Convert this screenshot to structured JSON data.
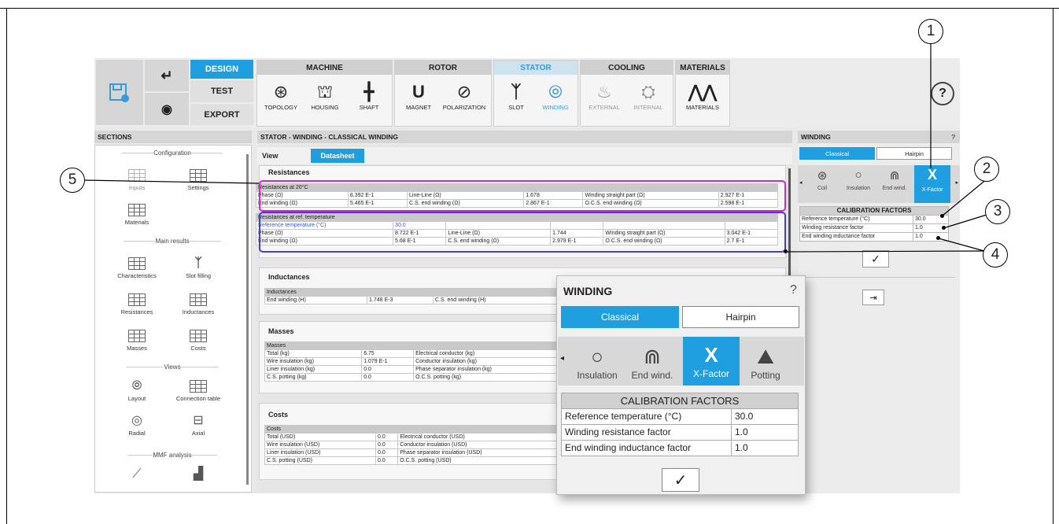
{
  "callouts": [
    "1",
    "2",
    "3",
    "4",
    "5"
  ],
  "toolbar": {
    "modes": {
      "design": "DESIGN",
      "test": "TEST",
      "export": "EXPORT"
    },
    "groups": {
      "machine": {
        "title": "MACHINE",
        "items": [
          "TOPOLOGY",
          "HOUSING",
          "SHAFT"
        ]
      },
      "rotor": {
        "title": "ROTOR",
        "items": [
          "MAGNET",
          "POLARIZATION"
        ]
      },
      "stator": {
        "title": "STATOR",
        "items": [
          "SLOT",
          "WINDING"
        ]
      },
      "cooling": {
        "title": "COOLING",
        "items": [
          "EXTERNAL",
          "INTERNAL"
        ]
      },
      "materials": {
        "title": "MATERIALS",
        "items": [
          "MATERIALS"
        ]
      }
    },
    "help": "?"
  },
  "sections": {
    "title": "SECTIONS",
    "groups": {
      "configuration": "Configuration",
      "main_results": "Main results",
      "views": "Views",
      "mmf": "MMF analysis"
    },
    "items": {
      "inputs": "Inputs",
      "settings": "Settings",
      "materials": "Materials",
      "characteristics": "Characteristics",
      "slot_filling": "Slot filling",
      "resistances": "Resistances",
      "inductances": "Inductances",
      "masses": "Masses",
      "costs": "Costs",
      "layout": "Layout",
      "connection_table": "Connection table",
      "radial": "Radial",
      "axial": "Axial"
    }
  },
  "main": {
    "title": "STATOR - WINDING - CLASSICAL WINDING",
    "view_label": "View",
    "datasheet_tab": "Datasheet",
    "resistances": {
      "title": "Resistances",
      "t20": {
        "header": "Resistances at 20°C",
        "rows": [
          [
            "Phase (Ω)",
            "8.392 E-1",
            "Line-Line (Ω)",
            "1.678",
            "Winding straight part (Ω)",
            "2.927 E-1"
          ],
          [
            "End winding (Ω)",
            "5.465 E-1",
            "C.S. end winding (Ω)",
            "2.867 E-1",
            "O.C.S. end winding (Ω)",
            "2.598 E-1"
          ]
        ]
      },
      "tref": {
        "header": "Resistances at ref. temperature",
        "ref_label": "Reference temperature (°C)",
        "ref_value": "30.0",
        "rows": [
          [
            "Phase (Ω)",
            "8.722 E-1",
            "Line-Line (Ω)",
            "1.744",
            "Winding straight part (Ω)",
            "3.042 E-1"
          ],
          [
            "End winding (Ω)",
            "5.68 E-1",
            "C.S. end winding (Ω)",
            "2.979 E-1",
            "O.C.S. end winding (Ω)",
            "2.7 E-1"
          ]
        ]
      }
    },
    "inductances": {
      "title": "Inductances",
      "header": "Inductances",
      "rows": [
        [
          "End winding (H)",
          "1.748 E-3",
          "C.S. end winding (H)"
        ]
      ]
    },
    "masses": {
      "title": "Masses",
      "header": "Masses",
      "rows": [
        [
          "Total (kg)",
          "6.75",
          "Electrical conductor (kg)"
        ],
        [
          "Wire insulation (kg)",
          "1.079 E-1",
          "Conductor insulation (kg)"
        ],
        [
          "Liner insulation (kg)",
          "0.0",
          "Phase separator insulation (kg)"
        ],
        [
          "C.S. potting (kg)",
          "0.0",
          "O.C.S. potting (kg)"
        ]
      ]
    },
    "costs": {
      "title": "Costs",
      "header": "Costs",
      "rows": [
        [
          "Total (USD)",
          "0.0",
          "Electrical conductor (USD)"
        ],
        [
          "Wire insulation (USD)",
          "0.0",
          "Conductor insulation (USD)"
        ],
        [
          "Liner insulation (USD)",
          "0.0",
          "Phase separator insulation (USD)"
        ],
        [
          "C.S. potting (USD)",
          "0.0",
          "O.C.S. potting (USD)"
        ]
      ]
    }
  },
  "winding_panel": {
    "title": "WINDING",
    "help": "?",
    "classical": "Classical",
    "hairpin": "Hairpin",
    "tabs": [
      "Coil",
      "Insulation",
      "End wind.",
      "X-Factor"
    ],
    "cal_title": "CALIBRATION FACTORS",
    "rows": [
      [
        "Reference temperature (°C)",
        "30.0"
      ],
      [
        "Winding resistance factor",
        "1.0"
      ],
      [
        "End winding inductance factor",
        "1.0"
      ]
    ]
  },
  "popup": {
    "title": "WINDING",
    "help": "?",
    "classical": "Classical",
    "hairpin": "Hairpin",
    "tabs": [
      "Insulation",
      "End wind.",
      "X-Factor",
      "Potting"
    ],
    "cal_title": "CALIBRATION FACTORS",
    "rows": [
      [
        "Reference temperature (°C)",
        "30.0"
      ],
      [
        "Winding resistance factor",
        "1.0"
      ],
      [
        "End winding inductance factor",
        "1.0"
      ]
    ]
  },
  "colors": {
    "accent": "#1f9fe0",
    "magenta_highlight": "#e020c8",
    "blue_highlight": "#3f3fdc"
  }
}
